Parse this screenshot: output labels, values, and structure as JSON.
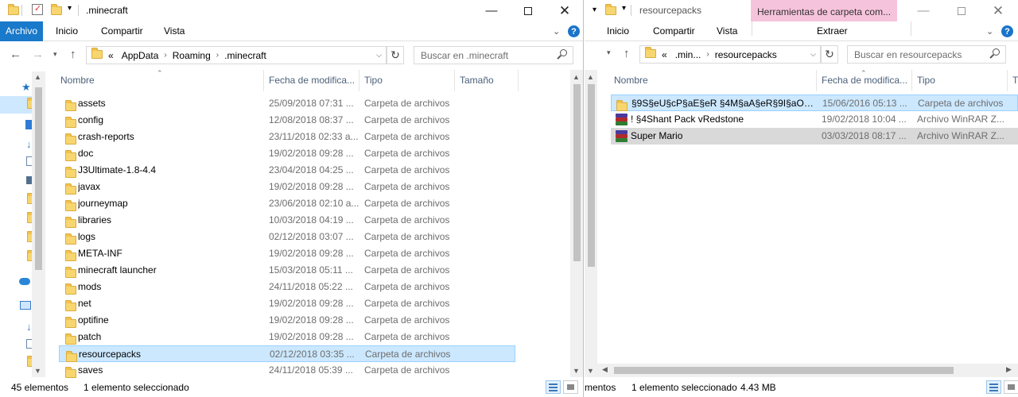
{
  "left": {
    "title": ".minecraft",
    "ribbon": {
      "file": "Archivo",
      "tabs": [
        "Inicio",
        "Compartir",
        "Vista"
      ]
    },
    "address": [
      "AppData",
      "Roaming",
      ".minecraft"
    ],
    "address_prefix": "«",
    "search_placeholder": "Buscar en .minecraft",
    "columns": {
      "name": "Nombre",
      "date": "Fecha de modifica...",
      "type": "Tipo",
      "size": "Tamaño"
    },
    "rows": [
      {
        "name": "assets",
        "date": "25/09/2018 07:31 ...",
        "type": "Carpeta de archivos"
      },
      {
        "name": "config",
        "date": "12/08/2018 08:37 ...",
        "type": "Carpeta de archivos"
      },
      {
        "name": "crash-reports",
        "date": "23/11/2018 02:33 a...",
        "type": "Carpeta de archivos"
      },
      {
        "name": "doc",
        "date": "19/02/2018 09:28 ...",
        "type": "Carpeta de archivos"
      },
      {
        "name": "J3Ultimate-1.8-4.4",
        "date": "23/04/2018 04:25 ...",
        "type": "Carpeta de archivos"
      },
      {
        "name": "javax",
        "date": "19/02/2018 09:28 ...",
        "type": "Carpeta de archivos"
      },
      {
        "name": "journeymap",
        "date": "23/06/2018 02:10 a...",
        "type": "Carpeta de archivos"
      },
      {
        "name": "libraries",
        "date": "10/03/2018 04:19 ...",
        "type": "Carpeta de archivos"
      },
      {
        "name": "logs",
        "date": "02/12/2018 03:07 ...",
        "type": "Carpeta de archivos"
      },
      {
        "name": "META-INF",
        "date": "19/02/2018 09:28 ...",
        "type": "Carpeta de archivos"
      },
      {
        "name": "minecraft launcher",
        "date": "15/03/2018 05:11 ...",
        "type": "Carpeta de archivos"
      },
      {
        "name": "mods",
        "date": "24/11/2018 05:22 ...",
        "type": "Carpeta de archivos"
      },
      {
        "name": "net",
        "date": "19/02/2018 09:28 ...",
        "type": "Carpeta de archivos"
      },
      {
        "name": "optifine",
        "date": "19/02/2018 09:28 ...",
        "type": "Carpeta de archivos"
      },
      {
        "name": "patch",
        "date": "19/02/2018 09:28 ...",
        "type": "Carpeta de archivos"
      },
      {
        "name": "resourcepacks",
        "date": "02/12/2018 03:35 ...",
        "type": "Carpeta de archivos",
        "selected": true
      },
      {
        "name": "saves",
        "date": "24/11/2018 05:39 ...",
        "type": "Carpeta de archivos"
      }
    ],
    "status": {
      "count": "45 elementos",
      "selection": "1 elemento seleccionado"
    }
  },
  "right": {
    "title": "resourcepacks",
    "context_tab": "Herramientas de carpeta com...",
    "ribbon": {
      "tabs": [
        "Inicio",
        "Compartir",
        "Vista"
      ],
      "extract": "Extraer"
    },
    "address": [
      ".min...",
      "resourcepacks"
    ],
    "address_prefix": "«",
    "search_placeholder": "Buscar en resourcepacks",
    "columns": {
      "name": "Nombre",
      "date": "Fecha de modifica...",
      "type": "Tipo",
      "extra": "T"
    },
    "rows": [
      {
        "icon": "folder-icon",
        "name": "§9S§eU§cP§aE§eR §4M§aA§eR§9I§aO §r- M...",
        "date": "15/06/2016 05:13 ...",
        "type": "Carpeta de archivos",
        "selected": "hover"
      },
      {
        "icon": "winrar-archive-icon",
        "name": "!     §4Shant Pack vRedstone",
        "date": "19/02/2018 10:04 ...",
        "type": "Archivo WinRAR Z..."
      },
      {
        "icon": "winrar-archive-icon",
        "name": "Super Mario",
        "date": "03/03/2018 08:17 ...",
        "type": "Archivo WinRAR Z...",
        "selected": "grey"
      }
    ],
    "status": {
      "count": "mentos",
      "selection": "1 elemento seleccionado",
      "size": "4.43 MB"
    }
  },
  "colors": {
    "accent": "#1979ca",
    "selection": "#cce8ff",
    "context_tab": "#f6c3dc"
  }
}
